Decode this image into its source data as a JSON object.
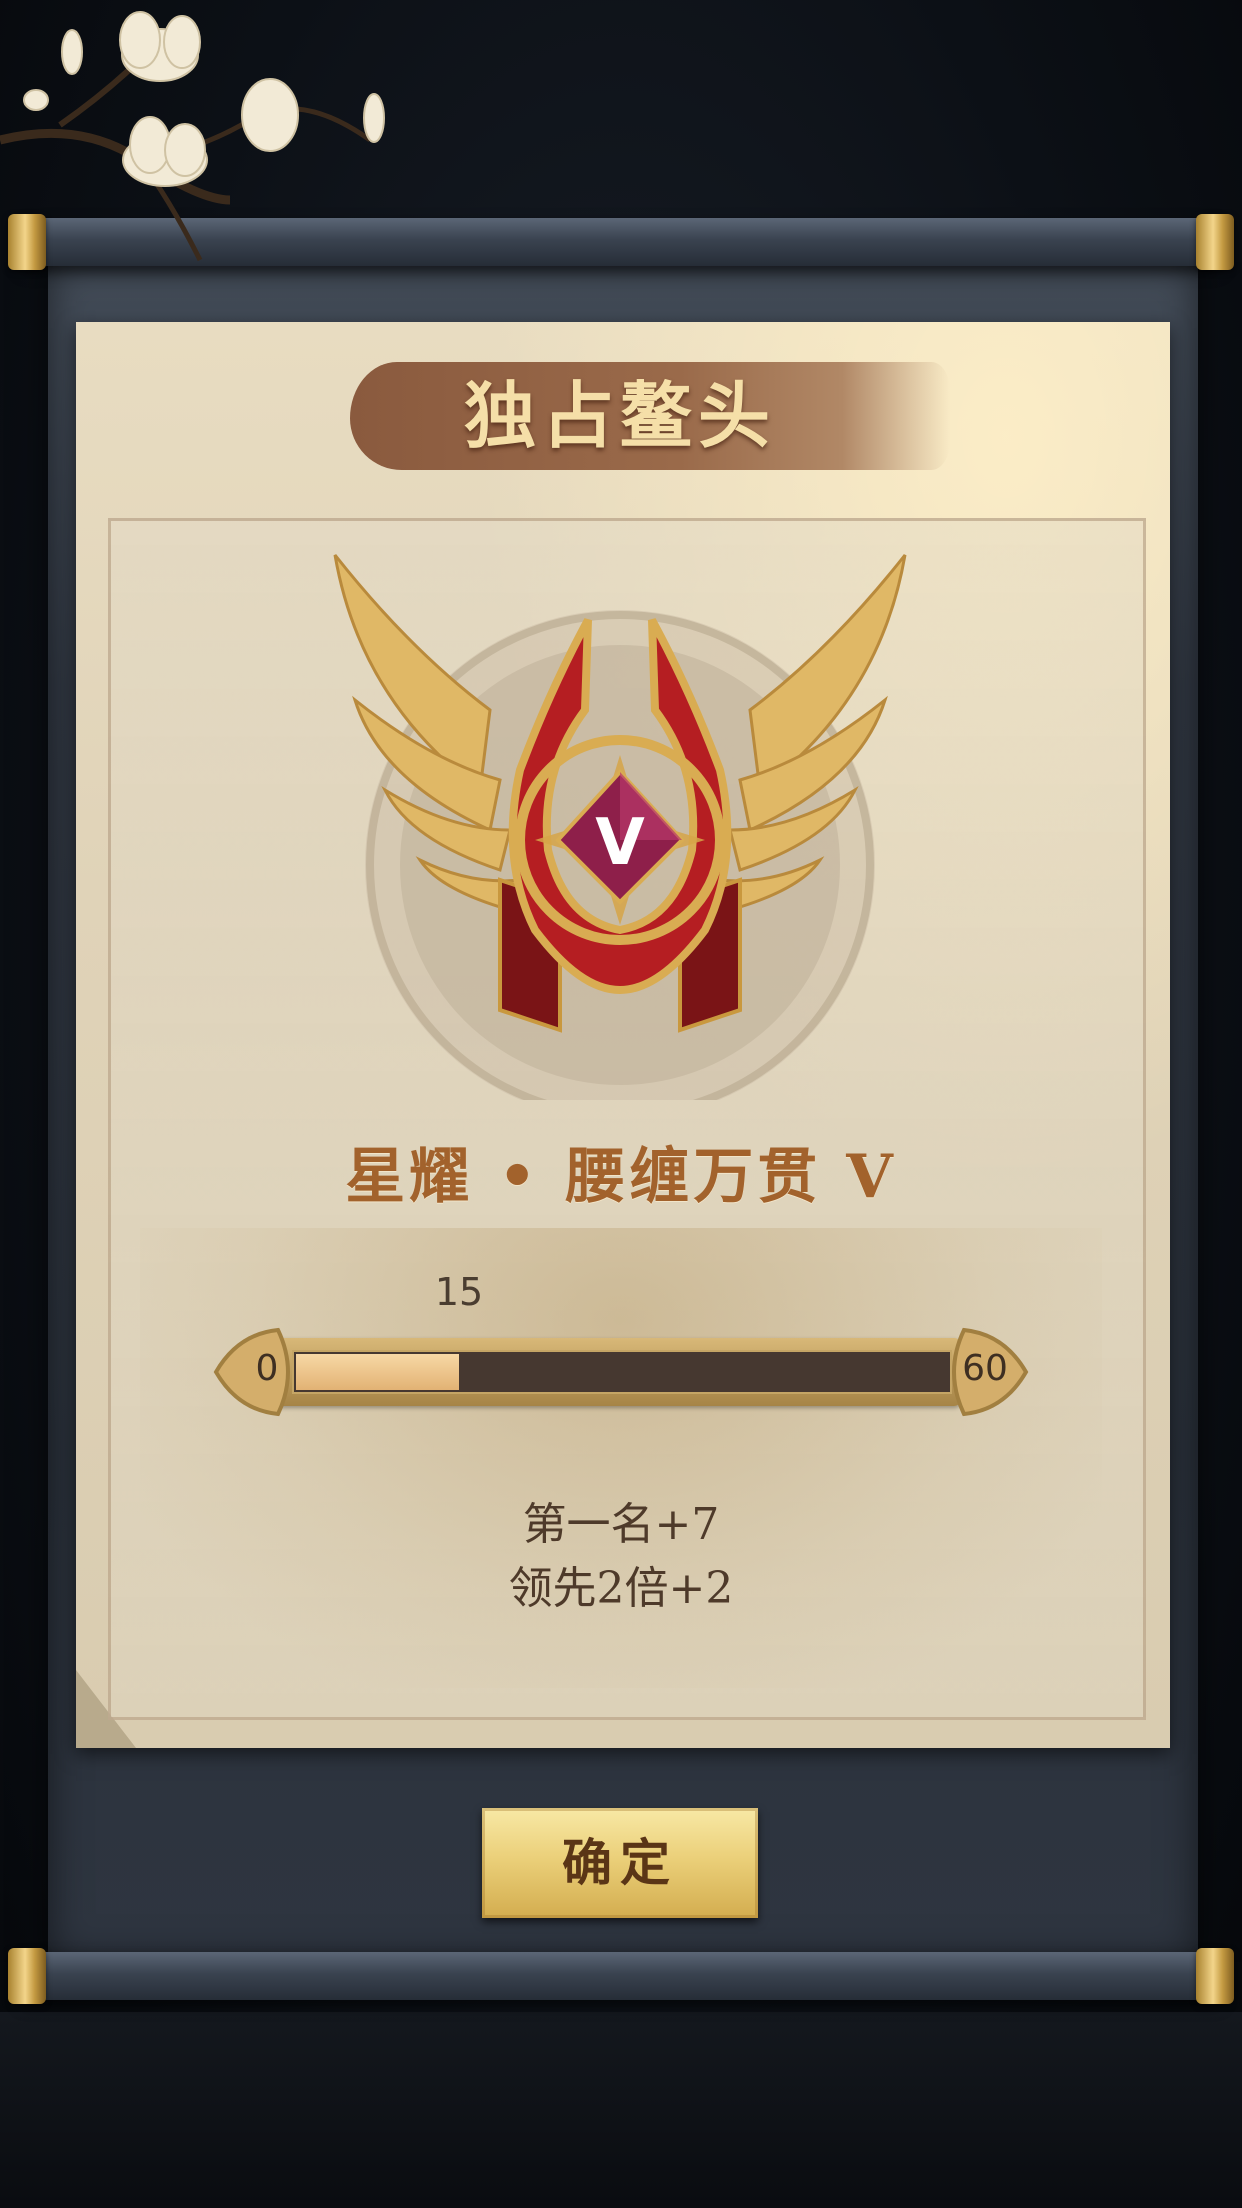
{
  "dialog": {
    "title": "独占鳌头",
    "badge": {
      "emblem_letter": "V",
      "name": "星耀 • 腰缠万贯 V",
      "accent": "#a2622c"
    },
    "progress": {
      "current": 15,
      "current_label": "15",
      "min_label": "0",
      "max_label": "60",
      "min": 0,
      "max": 60
    },
    "rewards": [
      "第一名+7",
      "领先2倍+2"
    ],
    "confirm_label": "确定"
  }
}
